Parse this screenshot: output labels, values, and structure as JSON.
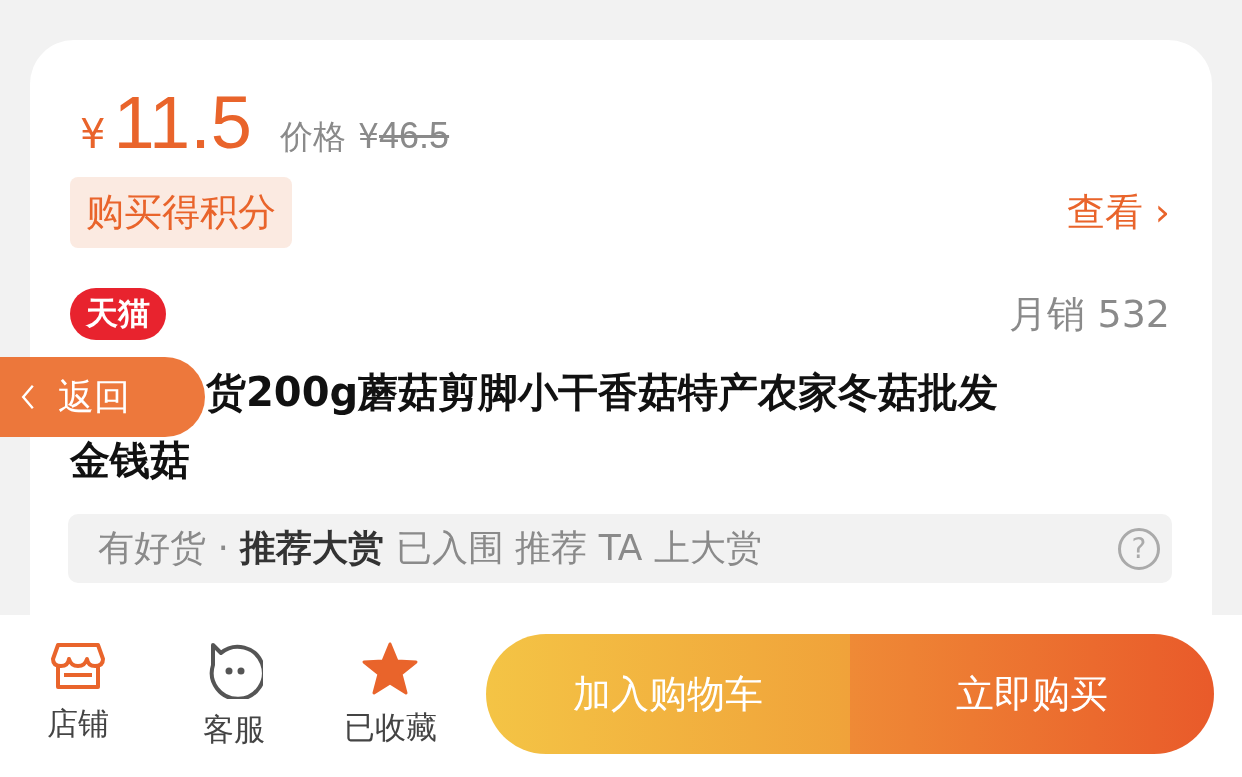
{
  "price": {
    "currency": "¥",
    "value": "11.5",
    "original_label": "价格",
    "original_currency": "¥",
    "original_value": "46.5"
  },
  "points": {
    "badge": "购买得积分",
    "link": "查看",
    "chevron": "›"
  },
  "product": {
    "platform_badge": "天猫",
    "monthly_sales": "月销 532",
    "title_lines": [
      "货200g蘑菇剪脚小干香菇特产农家冬菇批发",
      "金钱菇"
    ]
  },
  "award": {
    "text": "有好货 · **推荐大赏** 已入围 推荐 TA 上大赏",
    "help": "?"
  },
  "back_button": {
    "label": "返回"
  },
  "bottom_bar": {
    "actions": [
      {
        "kind": "shop",
        "label": "店铺"
      },
      {
        "kind": "service",
        "label": "客服"
      },
      {
        "kind": "favorite",
        "label": "已收藏",
        "selected": true
      }
    ],
    "cart_button": "加入购物车",
    "buy_button": "立即购买"
  }
}
